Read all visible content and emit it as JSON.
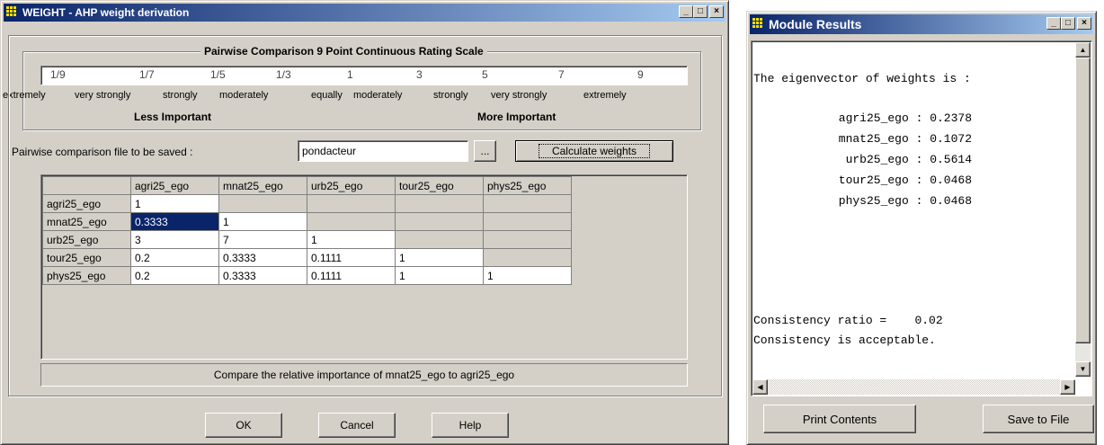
{
  "weight_window": {
    "title": "WEIGHT - AHP weight derivation",
    "scale_group_title": "Pairwise Comparison 9 Point Continuous Rating Scale",
    "scale_values": [
      "1/9",
      "1/7",
      "1/5",
      "1/3",
      "1",
      "3",
      "5",
      "7",
      "9"
    ],
    "scale_labels": [
      "extremely",
      "very strongly",
      "strongly",
      "moderately",
      "equally",
      "moderately",
      "strongly",
      "very strongly",
      "extremely"
    ],
    "less_important": "Less Important",
    "more_important": "More Important",
    "file_label": "Pairwise comparison file to be saved :",
    "file_value": "pondacteur",
    "browse_label": "...",
    "calculate_label": "Calculate weights",
    "columns": [
      "agri25_ego",
      "mnat25_ego",
      "urb25_ego",
      "tour25_ego",
      "phys25_ego"
    ],
    "rows": [
      {
        "name": "agri25_ego",
        "cells": [
          "1",
          "",
          "",
          "",
          ""
        ]
      },
      {
        "name": "mnat25_ego",
        "cells": [
          "0.3333",
          "1",
          "",
          "",
          ""
        ]
      },
      {
        "name": "urb25_ego",
        "cells": [
          "3",
          "7",
          "1",
          "",
          ""
        ]
      },
      {
        "name": "tour25_ego",
        "cells": [
          "0.2",
          "0.3333",
          "0.1111",
          "1",
          ""
        ]
      },
      {
        "name": "phys25_ego",
        "cells": [
          "0.2",
          "0.3333",
          "0.1111",
          "1",
          "1"
        ]
      }
    ],
    "status_text": "Compare the relative importance of mnat25_ego to agri25_ego",
    "ok_label": "OK",
    "cancel_label": "Cancel",
    "help_label": "Help"
  },
  "results_window": {
    "title": "Module Results",
    "heading": "The eigenvector of weights is :",
    "weights": [
      {
        "name": "agri25_ego",
        "value": "0.2378"
      },
      {
        "name": "mnat25_ego",
        "value": "0.1072"
      },
      {
        "name": "urb25_ego",
        "value": "0.5614"
      },
      {
        "name": "tour25_ego",
        "value": "0.0468"
      },
      {
        "name": "phys25_ego",
        "value": "0.0468"
      }
    ],
    "consistency_ratio_label": "Consistency ratio =",
    "consistency_ratio_value": "0.02",
    "consistency_message": "Consistency is acceptable.",
    "print_label": "Print Contents",
    "save_label": "Save to File"
  },
  "colors": {
    "titlebar_start": "#0a246a",
    "titlebar_end": "#a6caf0",
    "window_face": "#d4d0c8",
    "selection": "#0a246a"
  },
  "icons": [
    "app-grid-icon",
    "minimize-icon",
    "maximize-icon",
    "close-icon",
    "scroll-up-icon",
    "scroll-down-icon",
    "scroll-left-icon",
    "scroll-right-icon"
  ]
}
